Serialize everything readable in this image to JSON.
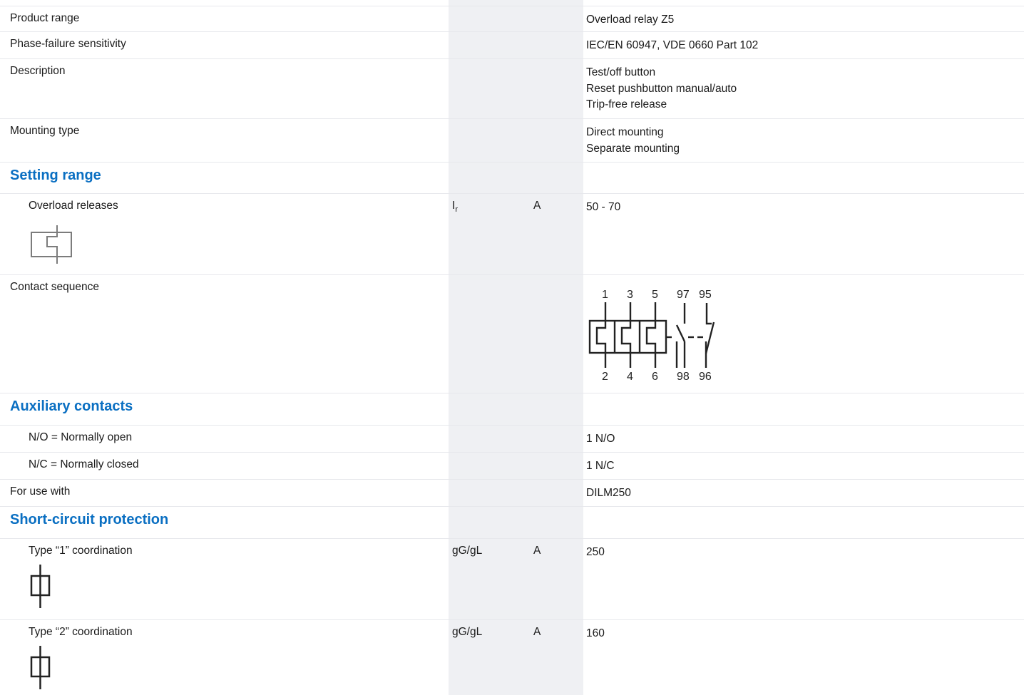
{
  "rows": {
    "product_range": {
      "label": "Product range",
      "value": "Overload relay Z5"
    },
    "phase_failure": {
      "label": "Phase-failure sensitivity",
      "value": "IEC/EN 60947, VDE 0660 Part 102"
    },
    "description": {
      "label": "Description",
      "values": [
        "Test/off button",
        "Reset pushbutton manual/auto",
        "Trip-free release"
      ]
    },
    "mounting": {
      "label": "Mounting type",
      "values": [
        "Direct mounting",
        "Separate mounting"
      ]
    },
    "overload": {
      "label": "Overload releases",
      "symbol": "I",
      "symbol_sub": "r",
      "unit": "A",
      "value": "50 - 70",
      "icon": "overload-release-icon"
    },
    "contact_sequence": {
      "label": "Contact sequence",
      "icon": "contact-sequence-diagram",
      "terminals_top": [
        "1",
        "3",
        "5",
        "97",
        "95"
      ],
      "terminals_bottom": [
        "2",
        "4",
        "6",
        "98",
        "96"
      ]
    },
    "no": {
      "label": "N/O = Normally open",
      "value": "1 N/O"
    },
    "nc": {
      "label": "N/C = Normally closed",
      "value": "1 N/C"
    },
    "for_use_with": {
      "label": "For use with",
      "value": "DILM250"
    },
    "type1": {
      "label": "Type “1” coordination",
      "symbol": "gG/gL",
      "unit": "A",
      "value": "250",
      "icon": "fuse-icon"
    },
    "type2": {
      "label": "Type “2” coordination",
      "symbol": "gG/gL",
      "unit": "A",
      "value": "160",
      "icon": "fuse-icon"
    }
  },
  "sections": {
    "setting_range": "Setting range",
    "auxiliary_contacts": "Auxiliary contacts",
    "short_circuit": "Short-circuit protection"
  },
  "colors": {
    "accent": "#0a6fc2",
    "column_shade": "#eff0f3",
    "divider": "#e7e8ec"
  }
}
